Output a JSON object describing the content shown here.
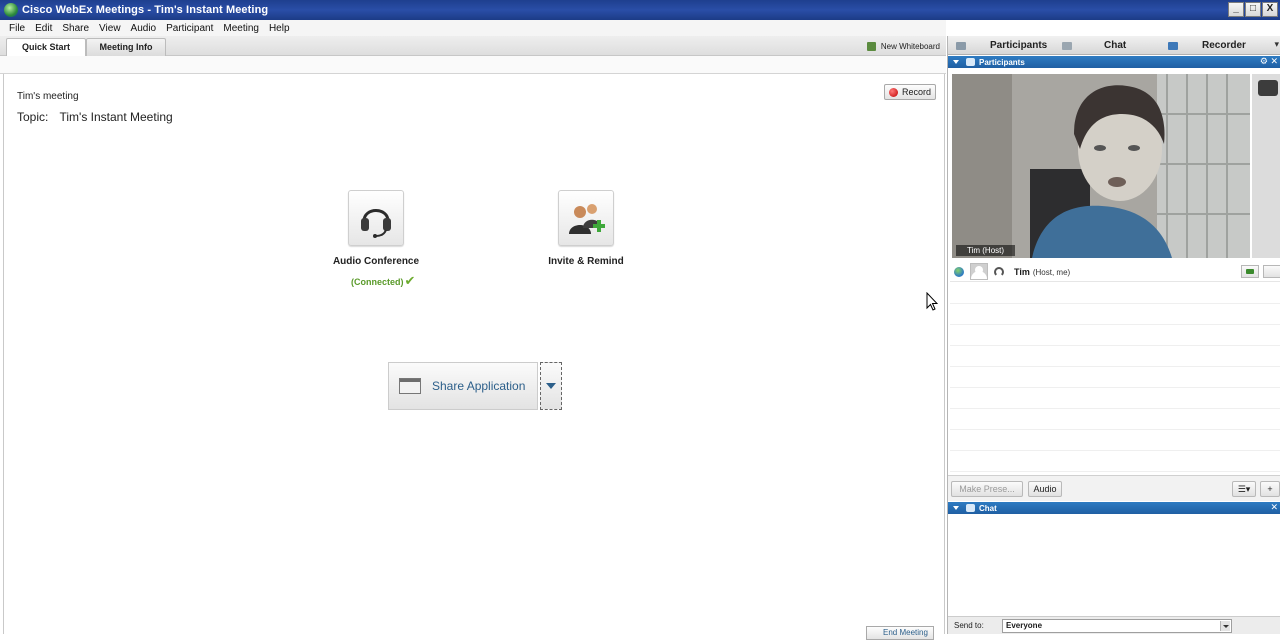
{
  "window": {
    "title": "Cisco WebEx Meetings - Tim's Instant Meeting",
    "controls": [
      "_",
      "□",
      "X"
    ]
  },
  "menu": [
    "File",
    "Edit",
    "Share",
    "View",
    "Audio",
    "Participant",
    "Meeting",
    "Help"
  ],
  "tabs": {
    "quick_start": "Quick Start",
    "meeting_info": "Meeting Info"
  },
  "whiteboard": {
    "label": "New Whiteboard"
  },
  "main": {
    "meeting_name": "Tim's meeting",
    "topic_label": "Topic:",
    "topic_value": "Tim's Instant Meeting",
    "record_label": "Record",
    "audio_conference_label": "Audio Conference",
    "audio_status": "(Connected)",
    "invite_label": "Invite & Remind",
    "share_label": "Share Application",
    "end_meeting_label": "End Meeting"
  },
  "panel": {
    "tabs": [
      "Participants",
      "Chat",
      "Recorder"
    ],
    "participants_header": "Participants",
    "video_label": "Tim (Host)",
    "participant": {
      "name": "Tim",
      "role": "(Host, me)"
    },
    "make_presenter_label": "Make Prese...",
    "audio_label": "Audio",
    "chat_header": "Chat",
    "send_to_label": "Send to:",
    "send_to_value": "Everyone"
  },
  "colors": {
    "titlebar": "#1e3f8f",
    "section_header": "#2e7bc2",
    "link_blue": "#2c5f8a",
    "connected_green": "#5a9a2a",
    "record_red": "#c00000"
  }
}
